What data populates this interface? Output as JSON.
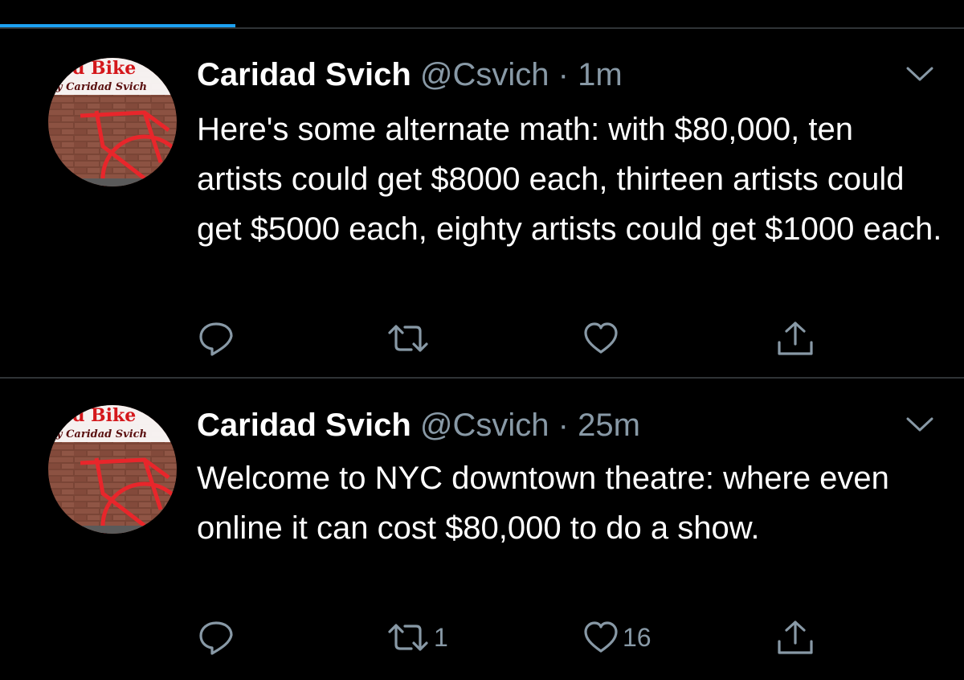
{
  "colors": {
    "background": "#000000",
    "accent": "#1da1f2",
    "secondary_text": "#8899a6",
    "divider": "#2f3336"
  },
  "tweets": [
    {
      "avatar": {
        "title": "d Bike",
        "byline": "y Caridad Svich"
      },
      "name": "Caridad Svich",
      "handle": "@Csvich",
      "separator": "·",
      "time": "1m",
      "text": "Here's some alternate math: with $80,000, ten artists could get $8000 each, thirteen artists could get $5000 each, eighty artists could get $1000 each.",
      "reply_icon": "reply-icon",
      "retweet_icon": "retweet-icon",
      "retweet_count": "",
      "like_icon": "heart-icon",
      "like_count": "",
      "share_icon": "share-icon",
      "menu_icon": "chevron-down-icon"
    },
    {
      "avatar": {
        "title": "d Bike",
        "byline": "y Caridad Svich"
      },
      "name": "Caridad Svich",
      "handle": "@Csvich",
      "separator": "·",
      "time": "25m",
      "text": "Welcome to NYC downtown theatre: where even online it can cost $80,000 to do a show.",
      "reply_icon": "reply-icon",
      "retweet_icon": "retweet-icon",
      "retweet_count": "1",
      "like_icon": "heart-icon",
      "like_count": "16",
      "share_icon": "share-icon",
      "menu_icon": "chevron-down-icon"
    }
  ]
}
